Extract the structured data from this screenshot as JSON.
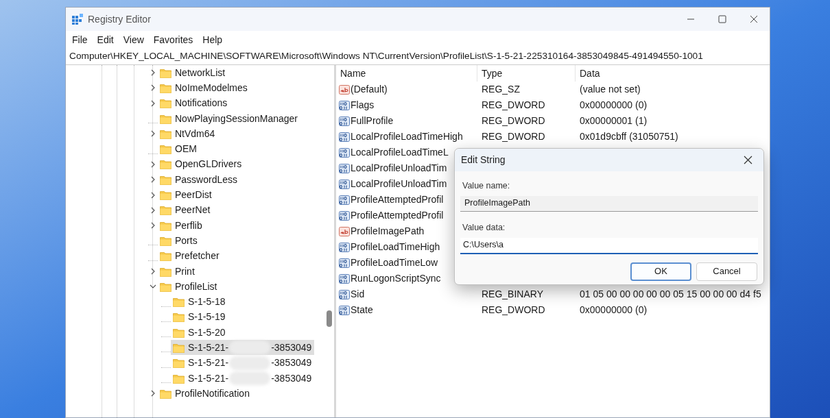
{
  "window": {
    "title": "Registry Editor"
  },
  "menu": [
    "File",
    "Edit",
    "View",
    "Favorites",
    "Help"
  ],
  "address": "Computer\\HKEY_LOCAL_MACHINE\\SOFTWARE\\Microsoft\\Windows NT\\CurrentVersion\\ProfileList\\S-1-5-21-225310164-3853049845-491494550-1001",
  "tree": [
    {
      "kind": "branch",
      "label": "NetworkList",
      "expanded": false,
      "selected": false
    },
    {
      "kind": "branch",
      "label": "NoImeModelmes",
      "expanded": false,
      "selected": false
    },
    {
      "kind": "branch",
      "label": "Notifications",
      "expanded": false,
      "selected": false
    },
    {
      "kind": "leaf",
      "label": "NowPlayingSessionManager",
      "selected": false
    },
    {
      "kind": "branch",
      "label": "NtVdm64",
      "expanded": false,
      "selected": false
    },
    {
      "kind": "leaf",
      "label": "OEM",
      "selected": false
    },
    {
      "kind": "branch",
      "label": "OpenGLDrivers",
      "expanded": false,
      "selected": false
    },
    {
      "kind": "branch",
      "label": "PasswordLess",
      "expanded": false,
      "selected": false
    },
    {
      "kind": "branch",
      "label": "PeerDist",
      "expanded": false,
      "selected": false
    },
    {
      "kind": "branch",
      "label": "PeerNet",
      "expanded": false,
      "selected": false
    },
    {
      "kind": "branch",
      "label": "Perflib",
      "expanded": false,
      "selected": false
    },
    {
      "kind": "leaf",
      "label": "Ports",
      "selected": false
    },
    {
      "kind": "leaf",
      "label": "Prefetcher",
      "selected": false
    },
    {
      "kind": "branch",
      "label": "Print",
      "expanded": false,
      "selected": false
    },
    {
      "kind": "branch",
      "label": "ProfileList",
      "expanded": true,
      "selected": false,
      "children": [
        {
          "kind": "leaf",
          "label": "S-1-5-18",
          "selected": false
        },
        {
          "kind": "leaf",
          "label": "S-1-5-19",
          "selected": false
        },
        {
          "kind": "leaf",
          "label": "S-1-5-20",
          "selected": false
        },
        {
          "kind": "leaf",
          "label": "S-1-5-21-",
          "label_end": "-3853049",
          "redacted": true,
          "selected": true
        },
        {
          "kind": "leaf",
          "label": "S-1-5-21-",
          "label_end": "-3853049",
          "redacted": true,
          "selected": false
        },
        {
          "kind": "leaf",
          "label": "S-1-5-21-",
          "label_end": "-3853049",
          "redacted": true,
          "selected": false
        }
      ]
    },
    {
      "kind": "branch",
      "label": "ProfileNotification",
      "expanded": false,
      "selected": false
    }
  ],
  "table": {
    "columns": [
      "Name",
      "Type",
      "Data"
    ],
    "rows": [
      {
        "kind": "string",
        "name": "(Default)",
        "type": "REG_SZ",
        "data": "(value not set)"
      },
      {
        "kind": "binary",
        "name": "Flags",
        "type": "REG_DWORD",
        "data": "0x00000000 (0)"
      },
      {
        "kind": "binary",
        "name": "FullProfile",
        "type": "REG_DWORD",
        "data": "0x00000001 (1)"
      },
      {
        "kind": "binary",
        "name": "LocalProfileLoadTimeHigh",
        "type": "REG_DWORD",
        "data": "0x01d9cbff (31050751)"
      },
      {
        "kind": "binary",
        "name": "LocalProfileLoadTimeL"
      },
      {
        "kind": "binary",
        "name": "LocalProfileUnloadTim"
      },
      {
        "kind": "binary",
        "name": "LocalProfileUnloadTim"
      },
      {
        "kind": "binary",
        "name": "ProfileAttemptedProfil"
      },
      {
        "kind": "binary",
        "name": "ProfileAttemptedProfil"
      },
      {
        "kind": "string",
        "name": "ProfileImagePath"
      },
      {
        "kind": "binary",
        "name": "ProfileLoadTimeHigh"
      },
      {
        "kind": "binary",
        "name": "ProfileLoadTimeLow"
      },
      {
        "kind": "binary",
        "name": "RunLogonScriptSync"
      },
      {
        "kind": "binary",
        "name": "Sid",
        "type": "REG_BINARY",
        "data": "01 05 00 00 00 00 00 05 15 00 00 00 d4 f5"
      },
      {
        "kind": "binary",
        "name": "State",
        "type": "REG_DWORD",
        "data": "0x00000000 (0)"
      }
    ]
  },
  "dialog": {
    "title": "Edit String",
    "name_label": "Value name:",
    "name_value": "ProfileImagePath",
    "data_label": "Value data:",
    "data_value": "C:\\Users\\a",
    "buttons": [
      "OK",
      "Cancel"
    ]
  }
}
